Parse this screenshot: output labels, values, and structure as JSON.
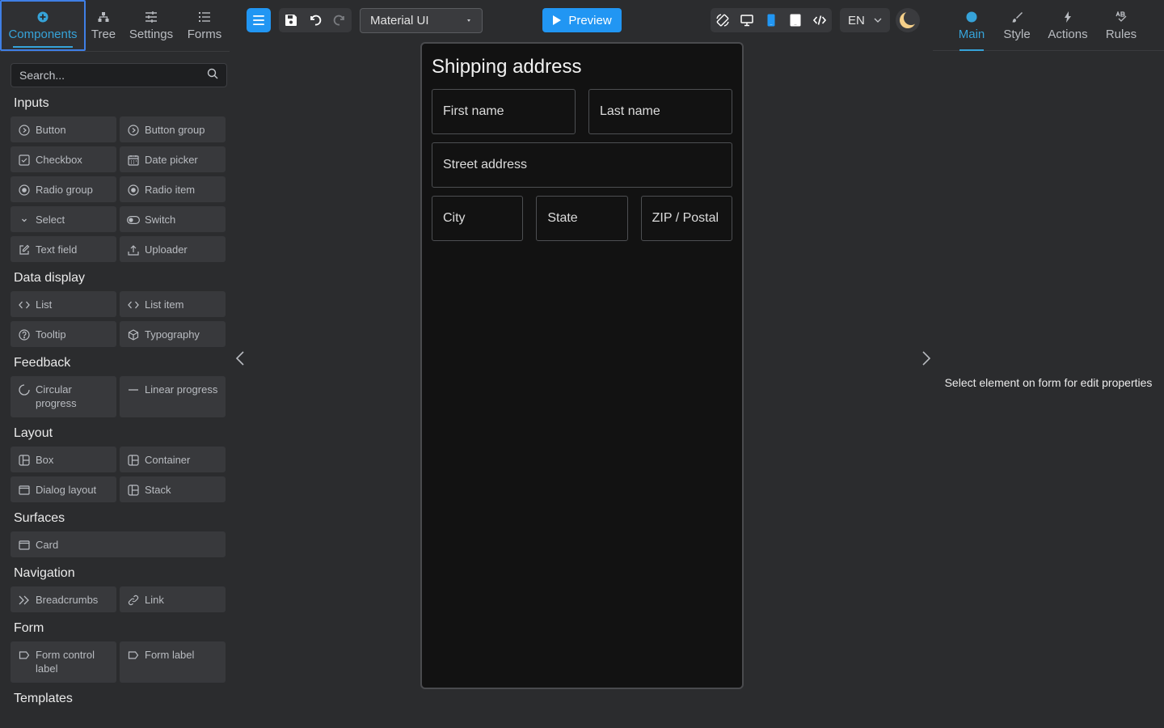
{
  "left_tabs": [
    {
      "label": "Components",
      "icon": "plus-circle-icon",
      "active": true
    },
    {
      "label": "Tree",
      "icon": "tree-icon"
    },
    {
      "label": "Settings",
      "icon": "sliders-icon"
    },
    {
      "label": "Forms",
      "icon": "list-icon"
    }
  ],
  "search": {
    "placeholder": "Search..."
  },
  "groups": {
    "inputs": {
      "title": "Inputs",
      "items": [
        "Button",
        "Button group",
        "Checkbox",
        "Date picker",
        "Radio group",
        "Radio item",
        "Select",
        "Switch",
        "Text field",
        "Uploader"
      ]
    },
    "data_display": {
      "title": "Data display",
      "items": [
        "List",
        "List item",
        "Tooltip",
        "Typography"
      ]
    },
    "feedback": {
      "title": "Feedback",
      "items": [
        "Circular progress",
        "Linear progress"
      ]
    },
    "layout": {
      "title": "Layout",
      "items": [
        "Box",
        "Container",
        "Dialog layout",
        "Stack"
      ]
    },
    "surfaces": {
      "title": "Surfaces",
      "items": [
        "Card"
      ]
    },
    "navigation": {
      "title": "Navigation",
      "items": [
        "Breadcrumbs",
        "Link"
      ]
    },
    "form": {
      "title": "Form",
      "items": [
        "Form control label",
        "Form label"
      ]
    },
    "templates": {
      "title": "Templates"
    }
  },
  "toolbar": {
    "theme_value": "Material UI",
    "preview_label": "Preview",
    "language": "EN"
  },
  "canvas": {
    "form_title": "Shipping address",
    "fields": {
      "first_name": "First name",
      "last_name": "Last name",
      "street": "Street address",
      "city": "City",
      "state": "State",
      "zip": "ZIP / Postal"
    }
  },
  "right_tabs": [
    {
      "label": "Main",
      "icon": "dot-icon",
      "active": true
    },
    {
      "label": "Style",
      "icon": "brush-icon"
    },
    {
      "label": "Actions",
      "icon": "lightning-icon"
    },
    {
      "label": "Rules",
      "icon": "rules-icon"
    }
  ],
  "right_panel": {
    "hint": "Select element on form for edit properties"
  },
  "colors": {
    "accent": "#2196f3",
    "active_tab": "#36a3d9",
    "background": "#2b2c2e",
    "canvas": "#121212"
  }
}
